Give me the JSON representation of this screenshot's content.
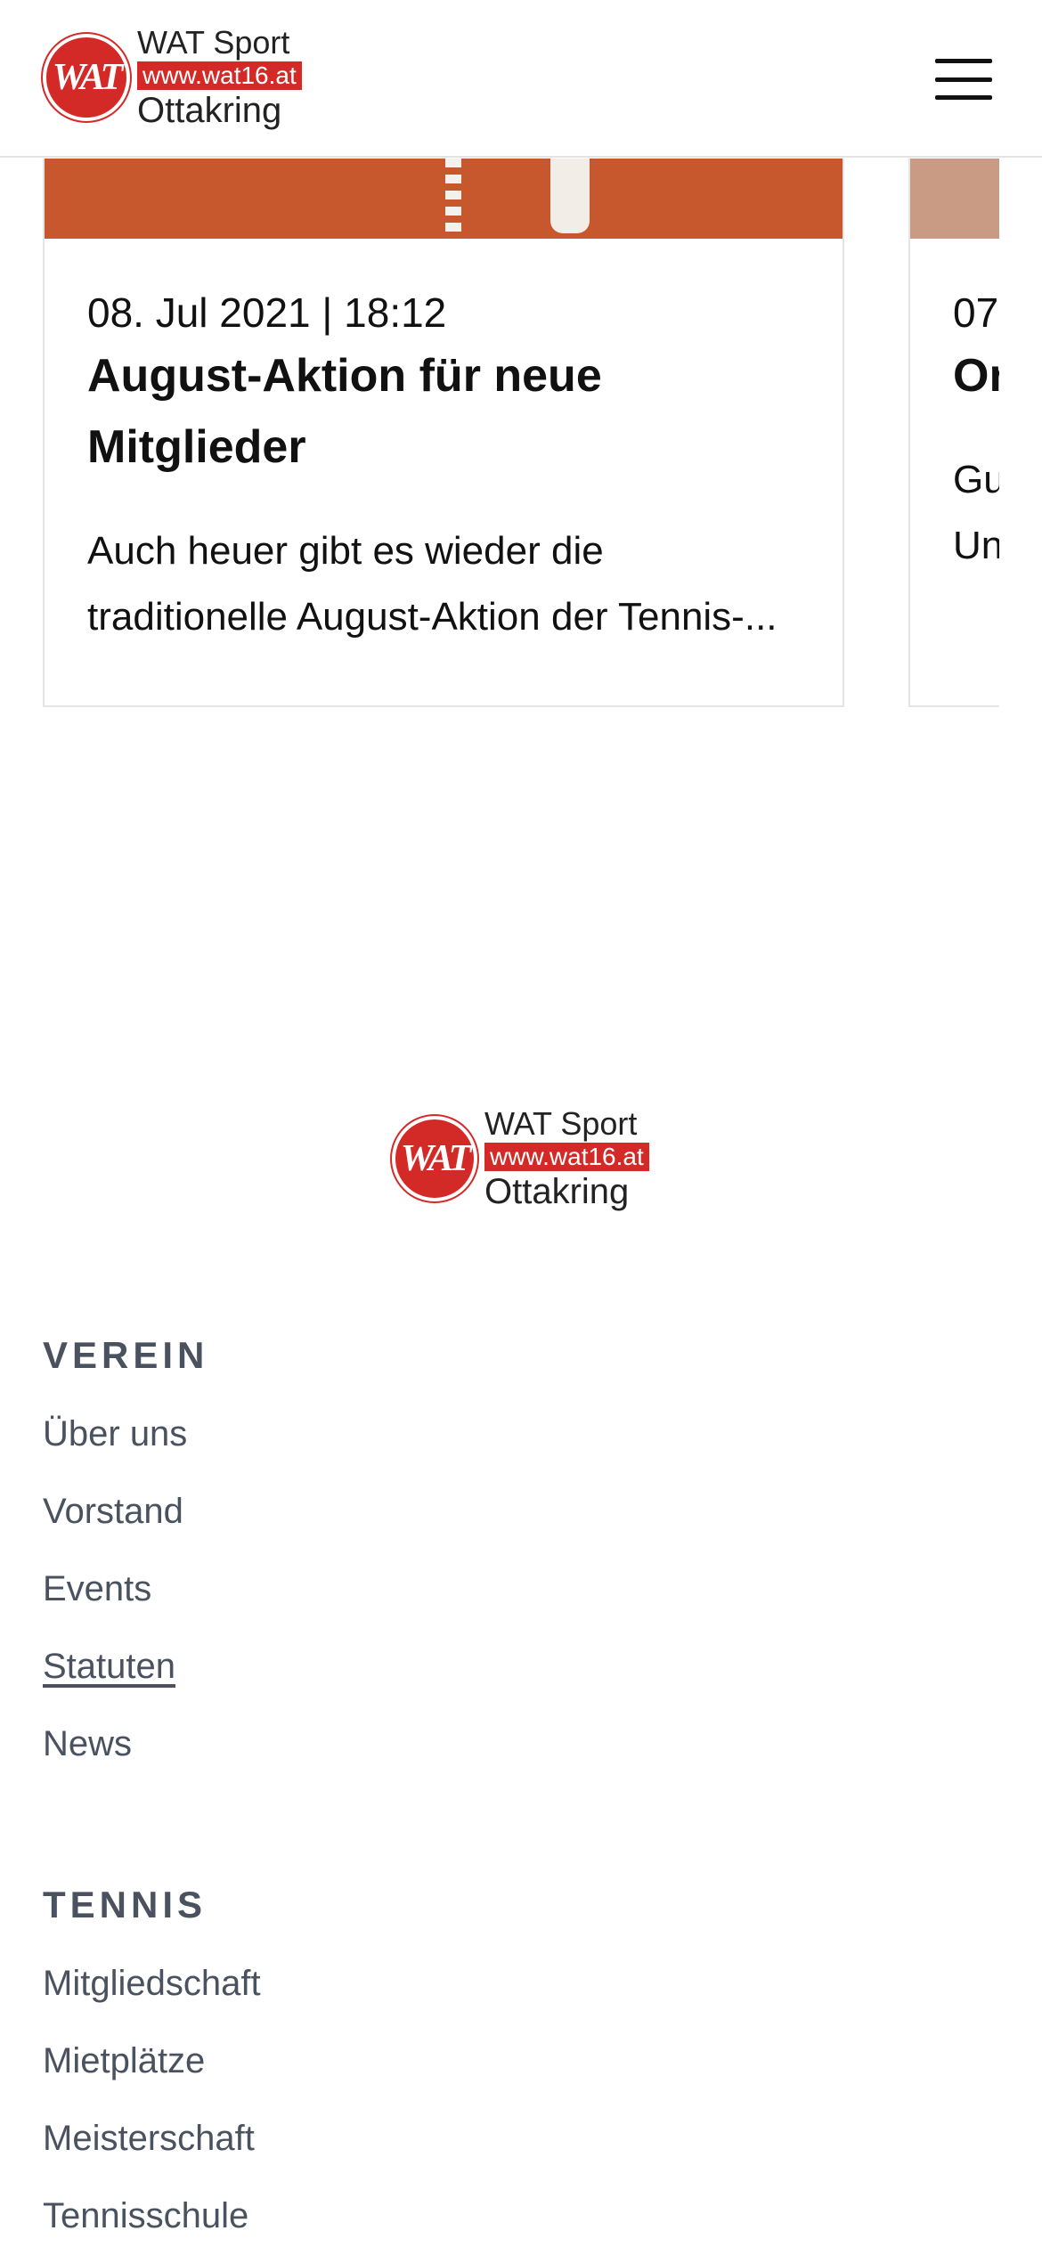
{
  "header": {
    "logo": {
      "badge": "WAT",
      "line1": "WAT Sport",
      "line2": "www.wat16.at",
      "line3": "Ottakring"
    },
    "menu_icon": "hamburger-icon"
  },
  "news": [
    {
      "date": "08. Jul 2021 | 18:12",
      "title": "August-Aktion für neue Mitglieder",
      "excerpt": "Auch heuer gibt es wieder die traditionelle August-Aktion der Tennis-..."
    },
    {
      "date": "07",
      "title": "Or",
      "excerpt": "Gu Un"
    }
  ],
  "footer": {
    "logo": {
      "badge": "WAT",
      "line1": "WAT Sport",
      "line2": "www.wat16.at",
      "line3": "Ottakring"
    },
    "verein": {
      "title": "VEREIN",
      "links": [
        "Über uns",
        "Vorstand",
        "Events",
        "Statuten",
        "News"
      ]
    },
    "tennis": {
      "title": "TENNIS",
      "links": [
        "Mitgliedschaft",
        "Mietplätze",
        "Meisterschaft",
        "Tennisschule"
      ]
    }
  },
  "colors": {
    "brand_red": "#d42a27",
    "footer_text": "#4a5260",
    "clay": "#c7582e"
  }
}
